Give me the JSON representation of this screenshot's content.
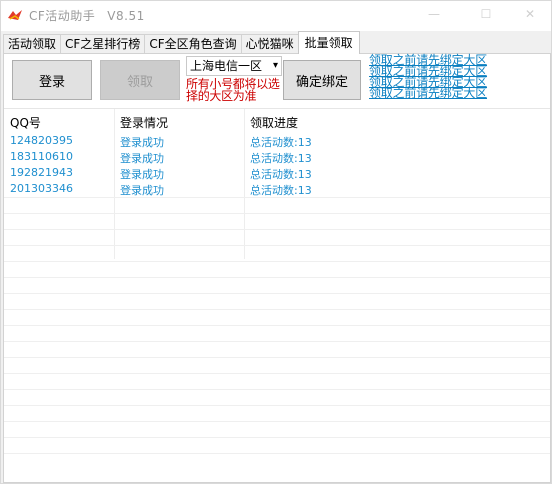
{
  "window": {
    "title": "CF活动助手",
    "version": "V8.51",
    "minimize_label": "—",
    "maximize_label": "☐",
    "close_label": "✕"
  },
  "tabs": [
    {
      "label": "活动领取"
    },
    {
      "label": "CF之星排行榜"
    },
    {
      "label": "CF全区角色查询"
    },
    {
      "label": "心悦猫咪"
    },
    {
      "label": "批量领取",
      "active": true
    }
  ],
  "toolbar": {
    "login_label": "登录",
    "claim_label": "领取",
    "bind_label": "确定绑定",
    "server_select": "上海电信一区",
    "note": "所有小号都将以选择的大区为准",
    "hints": [
      "领取之前请先绑定大区",
      "领取之前请先绑定大区",
      "领取之前请先绑定大区",
      "领取之前请先绑定大区"
    ]
  },
  "table": {
    "columns": [
      "QQ号",
      "登录情况",
      "领取进度"
    ],
    "rows": [
      [
        "124820395",
        "登录成功",
        "总活动数:13"
      ],
      [
        "183110610",
        "登录成功",
        "总活动数:13"
      ],
      [
        "192821943",
        "登录成功",
        "总活动数:13"
      ],
      [
        "201303346",
        "登录成功",
        "总活动数:13"
      ]
    ]
  },
  "colors": {
    "link": "#1f8fcf",
    "note": "#cc0000"
  }
}
